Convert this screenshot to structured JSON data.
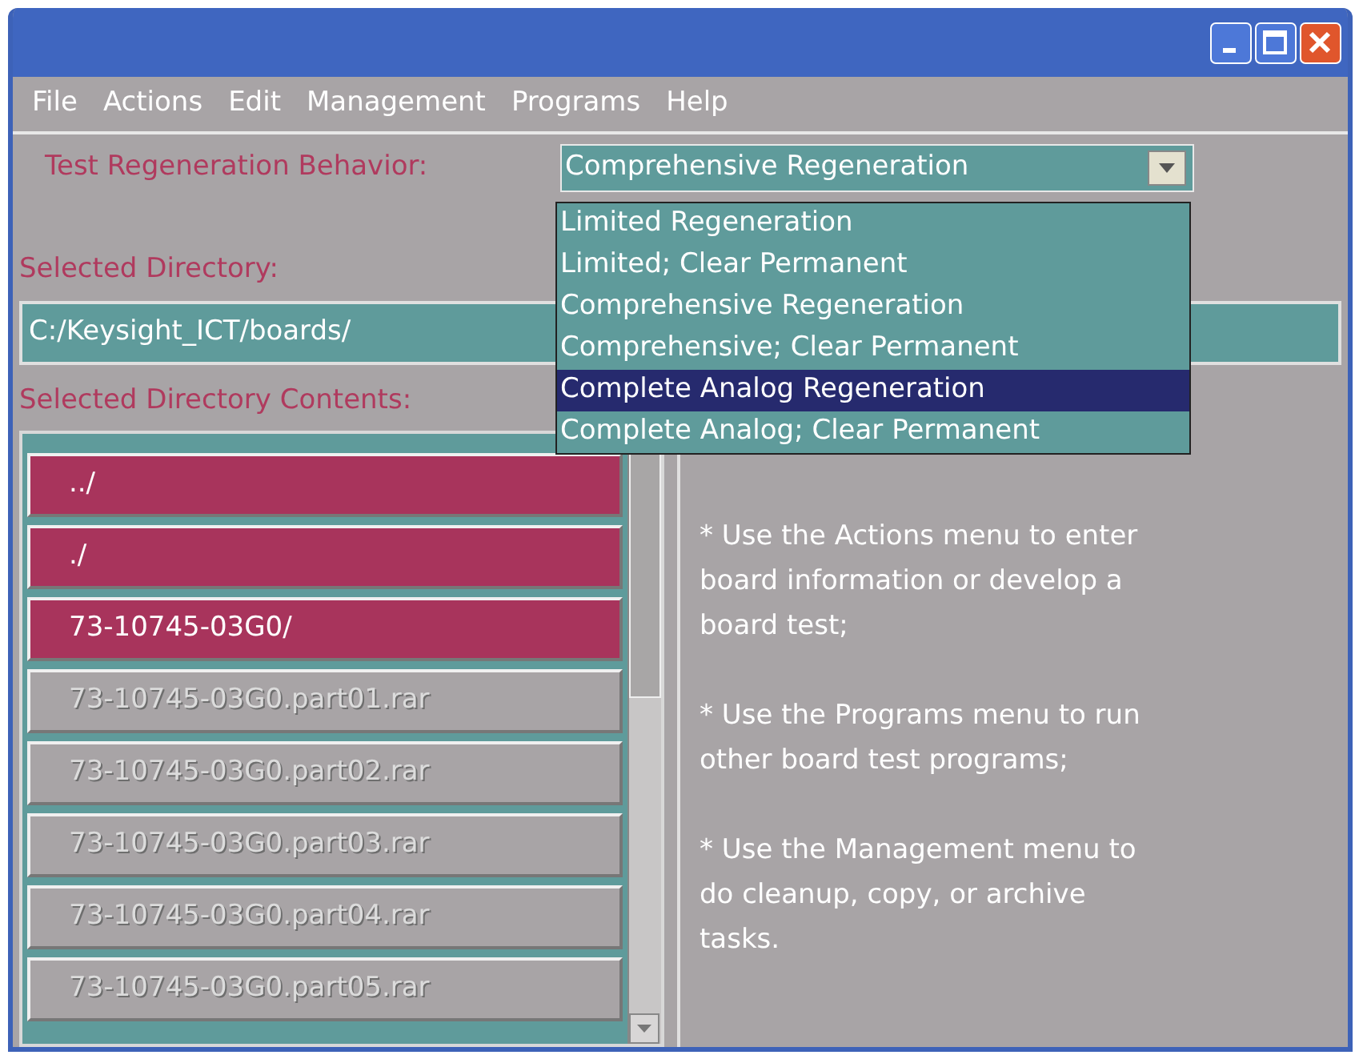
{
  "menu_bar": [
    "File",
    "Actions",
    "Edit",
    "Management",
    "Programs",
    "Help"
  ],
  "regeneration": {
    "label": "Test Regeneration Behavior:",
    "value": "Comprehensive Regeneration",
    "expanded": true,
    "options": [
      {
        "label": "Limited Regeneration",
        "highlighted": false
      },
      {
        "label": "Limited; Clear Permanent",
        "highlighted": false
      },
      {
        "label": "Comprehensive Regeneration",
        "highlighted": false
      },
      {
        "label": "Comprehensive; Clear Permanent",
        "highlighted": false
      },
      {
        "label": "Complete Analog Regeneration",
        "highlighted": true
      },
      {
        "label": "Complete Analog; Clear Permanent",
        "highlighted": false
      }
    ]
  },
  "selected_directory": {
    "label": "Selected Directory:",
    "value": "C:/Keysight_ICT/boards/"
  },
  "directory_contents": {
    "label": "Selected Directory Contents:",
    "items": [
      {
        "name": "../",
        "kind": "directory"
      },
      {
        "name": "./",
        "kind": "directory"
      },
      {
        "name": "73-10745-03G0/",
        "kind": "directory"
      },
      {
        "name": "73-10745-03G0.part01.rar",
        "kind": "file"
      },
      {
        "name": "73-10745-03G0.part02.rar",
        "kind": "file"
      },
      {
        "name": "73-10745-03G0.part03.rar",
        "kind": "file"
      },
      {
        "name": "73-10745-03G0.part04.rar",
        "kind": "file"
      },
      {
        "name": "73-10745-03G0.part05.rar",
        "kind": "file"
      }
    ]
  },
  "help_text": [
    "* Use the Actions menu to enter board information or develop a board test;",
    "* Use the Programs menu to run other board test programs;",
    "* Use the Management menu to do cleanup, copy, or archive tasks."
  ]
}
